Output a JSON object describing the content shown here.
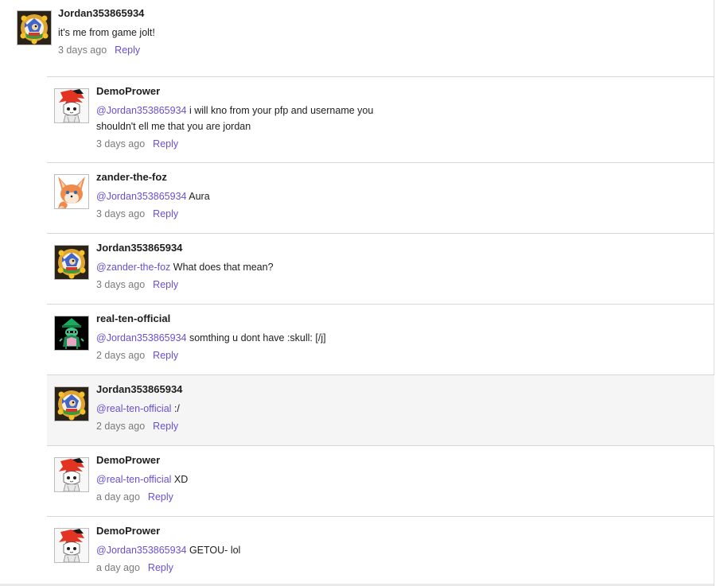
{
  "comments": [
    {
      "username": "Jordan353865934",
      "avatar": "sonic-badge-avatar",
      "mention": "",
      "text": "it's me from game jolt!",
      "time": "3 days ago",
      "reply": "Reply"
    },
    {
      "username": "DemoPrower",
      "avatar": "red-hair-cat-avatar",
      "mention": "@Jordan353865934",
      "text": " i will kno from your pfp and username you shouldn't ell me that you are jordan",
      "time": "3 days ago",
      "reply": "Reply"
    },
    {
      "username": "zander-the-foz",
      "avatar": "orange-fox-avatar",
      "mention": "@Jordan353865934",
      "text": " Aura",
      "time": "3 days ago",
      "reply": "Reply"
    },
    {
      "username": "Jordan353865934",
      "avatar": "sonic-badge-avatar",
      "mention": "@zander-the-foz",
      "text": " What does that mean?",
      "time": "3 days ago",
      "reply": "Reply"
    },
    {
      "username": "real-ten-official",
      "avatar": "green-goat-dark-avatar",
      "mention": "@Jordan353865934",
      "text": " somthing u dont have :skull: [/j]",
      "time": "2 days ago",
      "reply": "Reply"
    },
    {
      "username": "Jordan353865934",
      "avatar": "sonic-badge-avatar",
      "mention": "@real-ten-official",
      "text": " :/",
      "time": "2 days ago",
      "reply": "Reply"
    },
    {
      "username": "DemoPrower",
      "avatar": "red-hair-cat-avatar",
      "mention": "@real-ten-official",
      "text": " XD",
      "time": "a day ago",
      "reply": "Reply"
    },
    {
      "username": "DemoPrower",
      "avatar": "red-hair-cat-avatar",
      "mention": "@Jordan353865934",
      "text": " GETOU- lol",
      "time": "a day ago",
      "reply": "Reply"
    }
  ],
  "colors": {
    "link": "#6a4fd0",
    "meta": "#7a7a7a",
    "divider": "#d6d6d6",
    "highlight": "#f5f5f5"
  }
}
